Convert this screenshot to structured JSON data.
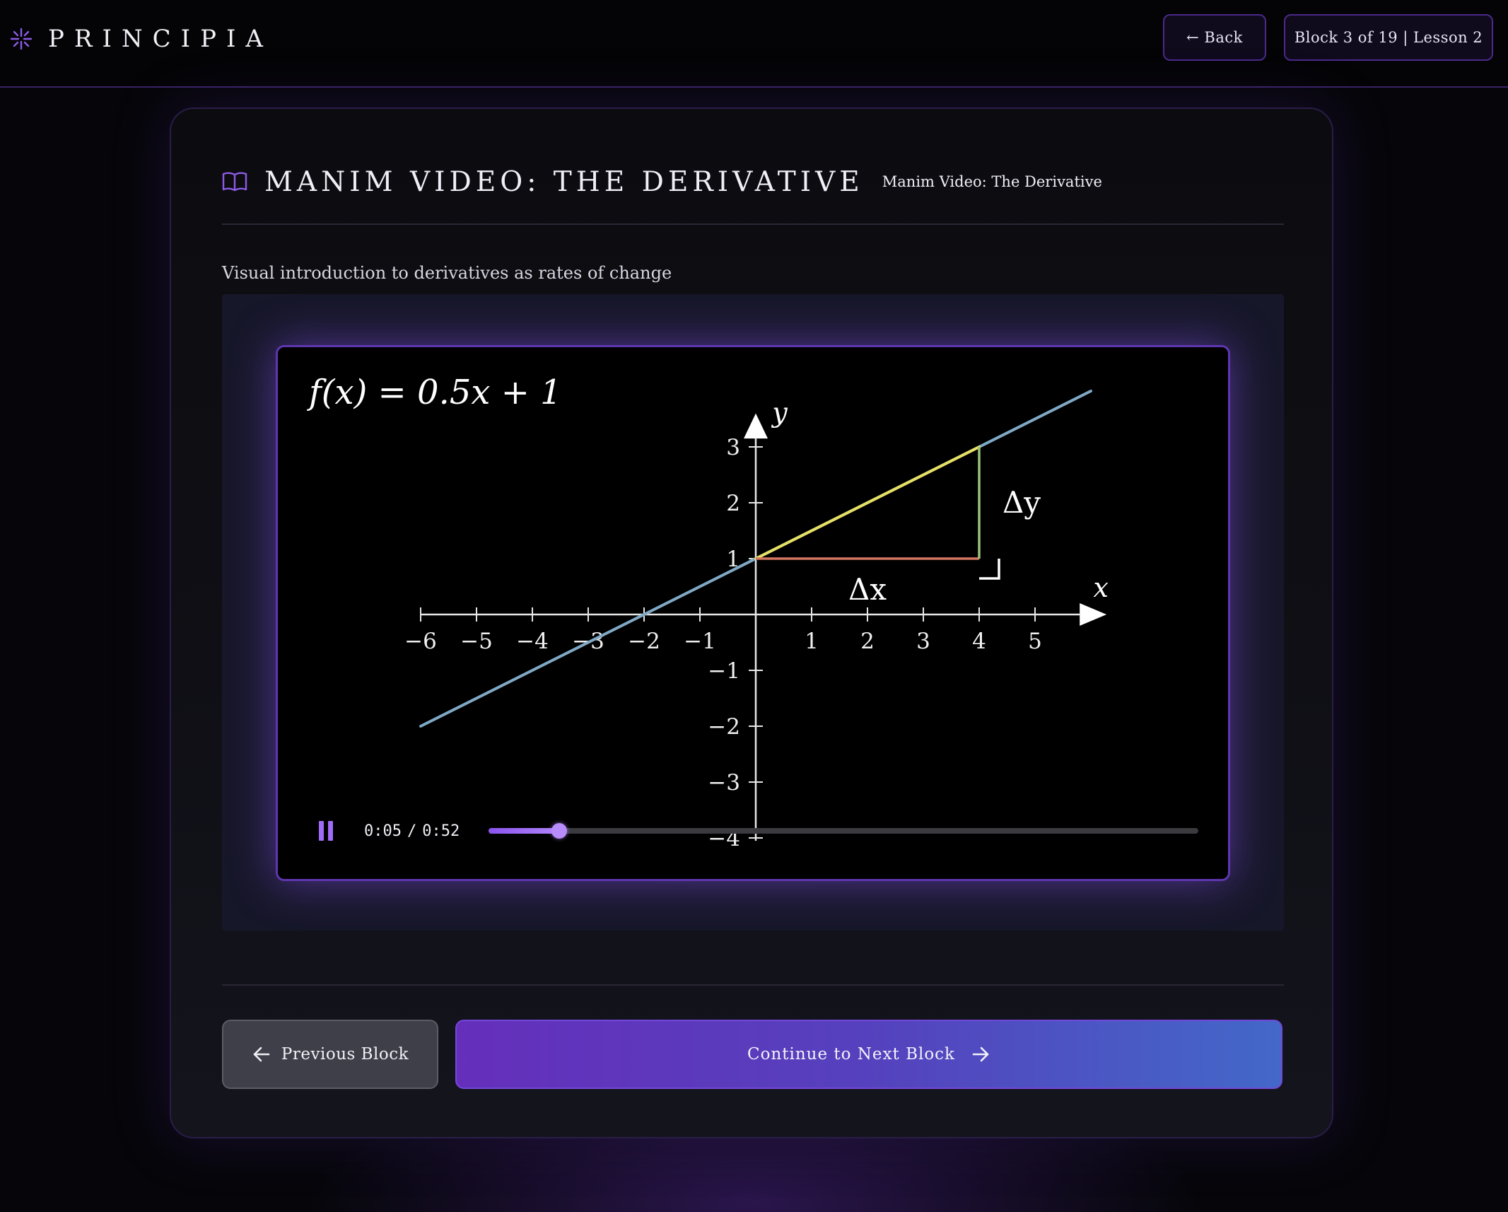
{
  "header": {
    "brand": "PRINCIPIA",
    "back_label": "← Back",
    "progress_label": "Block 3 of 19 | Lesson 2"
  },
  "block": {
    "title": "MANIM VIDEO: THE DERIVATIVE",
    "subtitle": "Manim Video: The Derivative",
    "description": "Visual introduction to derivatives as rates of change"
  },
  "video": {
    "current_time": "0:05",
    "time_separator": "/",
    "duration": "0:52",
    "progress": 0.1,
    "is_playing": true
  },
  "chart_data": {
    "type": "line",
    "title": "f(x) = 0.5x + 1",
    "xlabel": "x",
    "ylabel": "y",
    "xlim": [
      -6,
      6
    ],
    "ylim": [
      -4,
      3.5
    ],
    "x_ticks": [
      "−6",
      "−5",
      "−4",
      "−3",
      "−2",
      "−1",
      "1",
      "2",
      "3",
      "4",
      "5"
    ],
    "y_ticks": [
      "3",
      "2",
      "1",
      "−1",
      "−2",
      "−3",
      "−4"
    ],
    "series": [
      {
        "name": "f(x) = 0.5x + 1",
        "x": [
          -6,
          6
        ],
        "y": [
          -2,
          4
        ],
        "color": "#7ea9c6"
      }
    ],
    "annotations": {
      "secant": {
        "from": [
          0,
          1
        ],
        "to": [
          4,
          3
        ],
        "color": "#e6e164"
      },
      "delta_x": {
        "label": "Δx",
        "from": [
          0,
          1
        ],
        "to": [
          4,
          1
        ],
        "color": "#d57762"
      },
      "delta_y": {
        "label": "Δy",
        "from": [
          4,
          1
        ],
        "to": [
          4,
          3
        ],
        "color": "#9bc27c"
      }
    }
  },
  "footer": {
    "prev_label": "Previous Block",
    "next_label": "Continue to Next Block"
  },
  "colors": {
    "accent": "#7c4ddd",
    "next_gradient_start": "#652fbb",
    "next_gradient_end": "#4368c9"
  }
}
